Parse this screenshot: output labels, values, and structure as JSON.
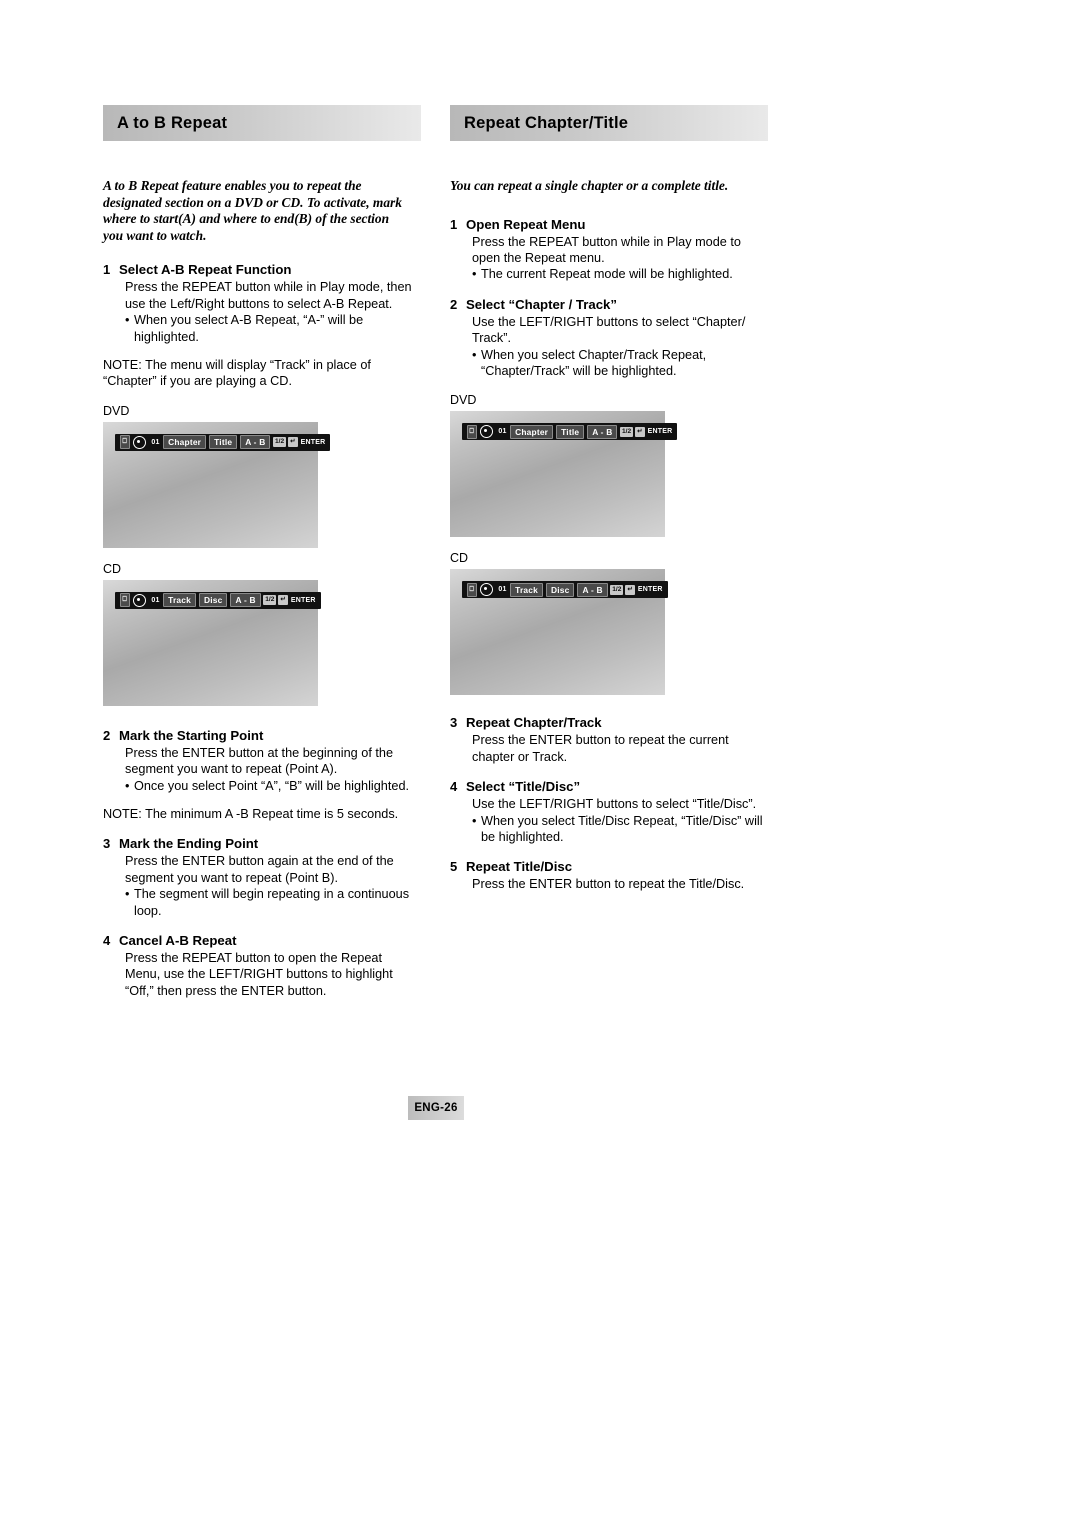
{
  "left_section": {
    "header": "A to B Repeat",
    "intro": "A to B Repeat feature enables you to repeat the designated section on a DVD or CD.  To activate, mark where to start(A) and where to end(B) of the section you want to watch.",
    "steps": [
      {
        "num": "1",
        "title": "Select A-B Repeat Function",
        "body": "Press the REPEAT button while in Play mode, then use the Left/Right buttons to select A-B Repeat.",
        "bullet": "When you select A-B Repeat, “A-” will be highlighted."
      },
      {
        "num": "2",
        "title": "Mark the Starting Point",
        "body": "Press the ENTER button at the beginning of the segment you want to repeat (Point A).",
        "bullet": "Once you select Point “A”, “B” will be highlighted."
      },
      {
        "num": "3",
        "title": "Mark the Ending Point",
        "body": "Press the ENTER button again at the end of the segment you want to repeat (Point B).",
        "bullet": "The segment will begin repeating in a continuous loop."
      },
      {
        "num": "4",
        "title": "Cancel A-B Repeat",
        "body": "Press the REPEAT button to open the Repeat Menu, use the LEFT/RIGHT buttons to highlight “Off,” then press the ENTER button.",
        "bullet": ""
      }
    ],
    "note_1": "NOTE: The menu will display “Track” in place of “Chapter” if you are playing a CD.",
    "note_2": "NOTE: The minimum A -B Repeat time is 5 seconds.",
    "screens": [
      {
        "label": "DVD",
        "osd": {
          "chapter_no": "01",
          "items": [
            "Chapter",
            "Title",
            "A - B"
          ],
          "tag1": "1/2",
          "tag2": "↵",
          "enter": "ENTER"
        }
      },
      {
        "label": "CD",
        "osd": {
          "chapter_no": "01",
          "items": [
            "Track",
            "Disc",
            "A - B"
          ],
          "tag1": "1/2",
          "tag2": "↵",
          "enter": "ENTER"
        }
      }
    ]
  },
  "right_section": {
    "header": "Repeat Chapter/Title",
    "intro": "You can repeat a single chapter or a complete title.",
    "steps_top": [
      {
        "num": "1",
        "title": "Open Repeat Menu",
        "body": "Press the REPEAT button while in Play mode to open the Repeat menu.",
        "bullet": "The current Repeat mode will be highlighted."
      },
      {
        "num": "2",
        "title": "Select “Chapter / Track”",
        "body": "Use the LEFT/RIGHT buttons to select “Chapter/ Track”.",
        "bullet": "When you select Chapter/Track Repeat, “Chapter/Track” will be highlighted."
      }
    ],
    "steps_bottom": [
      {
        "num": "3",
        "title": "Repeat Chapter/Track",
        "body": "Press the ENTER button to repeat the current chapter or Track.",
        "bullet": ""
      },
      {
        "num": "4",
        "title": "Select “Title/Disc”",
        "body": "Use the LEFT/RIGHT buttons to select “Title/Disc”.",
        "bullet": "When you select Title/Disc Repeat, “Title/Disc” will be highlighted."
      },
      {
        "num": "5",
        "title": "Repeat Title/Disc",
        "body": "Press the ENTER button to repeat the Title/Disc.",
        "bullet": ""
      }
    ],
    "screens": [
      {
        "label": "DVD",
        "osd": {
          "chapter_no": "01",
          "items": [
            "Chapter",
            "Title",
            "A - B"
          ],
          "tag1": "1/2",
          "tag2": "↵",
          "enter": "ENTER"
        }
      },
      {
        "label": "CD",
        "osd": {
          "chapter_no": "01",
          "items": [
            "Track",
            "Disc",
            "A - B"
          ],
          "tag1": "1/2",
          "tag2": "↵",
          "enter": "ENTER"
        }
      }
    ]
  },
  "footer": {
    "page_label": "ENG-26"
  }
}
